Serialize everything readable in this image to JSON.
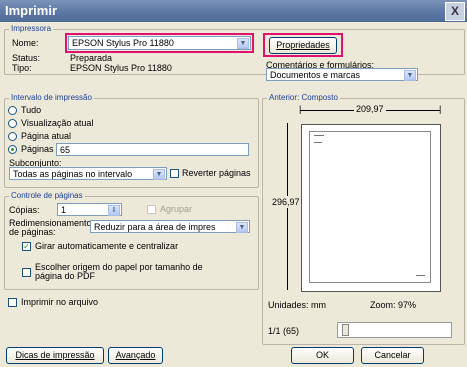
{
  "window": {
    "title": "Imprimir",
    "close_glyph": "X"
  },
  "printer": {
    "group_label": "Impressora",
    "name_label": "Nome:",
    "name_value": "EPSON Stylus Pro 11880",
    "status_label": "Status:",
    "status_value": "Preparada",
    "type_label": "Tipo:",
    "type_value": "EPSON Stylus Pro 11880",
    "properties_button": "Propriedades",
    "comments_label": "Comentários e formulários:",
    "comments_value": "Documentos e marcas"
  },
  "range": {
    "group_label": "Intervalo de impressão",
    "all": "Tudo",
    "current_view": "Visualização atual",
    "current_page": "Página atual",
    "pages_label": "Páginas",
    "pages_value": "65",
    "subset_label": "Subconjunto:",
    "subset_value": "Todas as páginas no intervalo",
    "reverse_label": "Reverter páginas"
  },
  "handling": {
    "group_label": "Controle de páginas",
    "copies_label": "Cópias:",
    "copies_value": "1",
    "collate_label": "Agrupar",
    "scaling_label_1": "Redimensionamento",
    "scaling_label_2": "de páginas:",
    "scaling_value": "Reduzir para a área de impres",
    "auto_rotate": "Girar automaticamente e centralizar",
    "paper_source_1": "Escolher origem do papel por tamanho de",
    "paper_source_2": "página do PDF"
  },
  "print_to_file": "Imprimir no arquivo",
  "preview": {
    "group_label": "Anterior: Composto",
    "width_value": "209,97",
    "height_value": "296,97",
    "units_label": "Unidades: mm",
    "zoom_label": "Zoom: 97%",
    "page_counter": "1/1 (65)"
  },
  "footer": {
    "tips_button": "Dicas de impressão",
    "advanced_button": "Avançado",
    "ok_button": "OK",
    "cancel_button": "Cancelar"
  },
  "colors": {
    "highlight": "#e0116f",
    "title_bar": "#5f7aa6",
    "group_label": "#1d3f9c"
  }
}
